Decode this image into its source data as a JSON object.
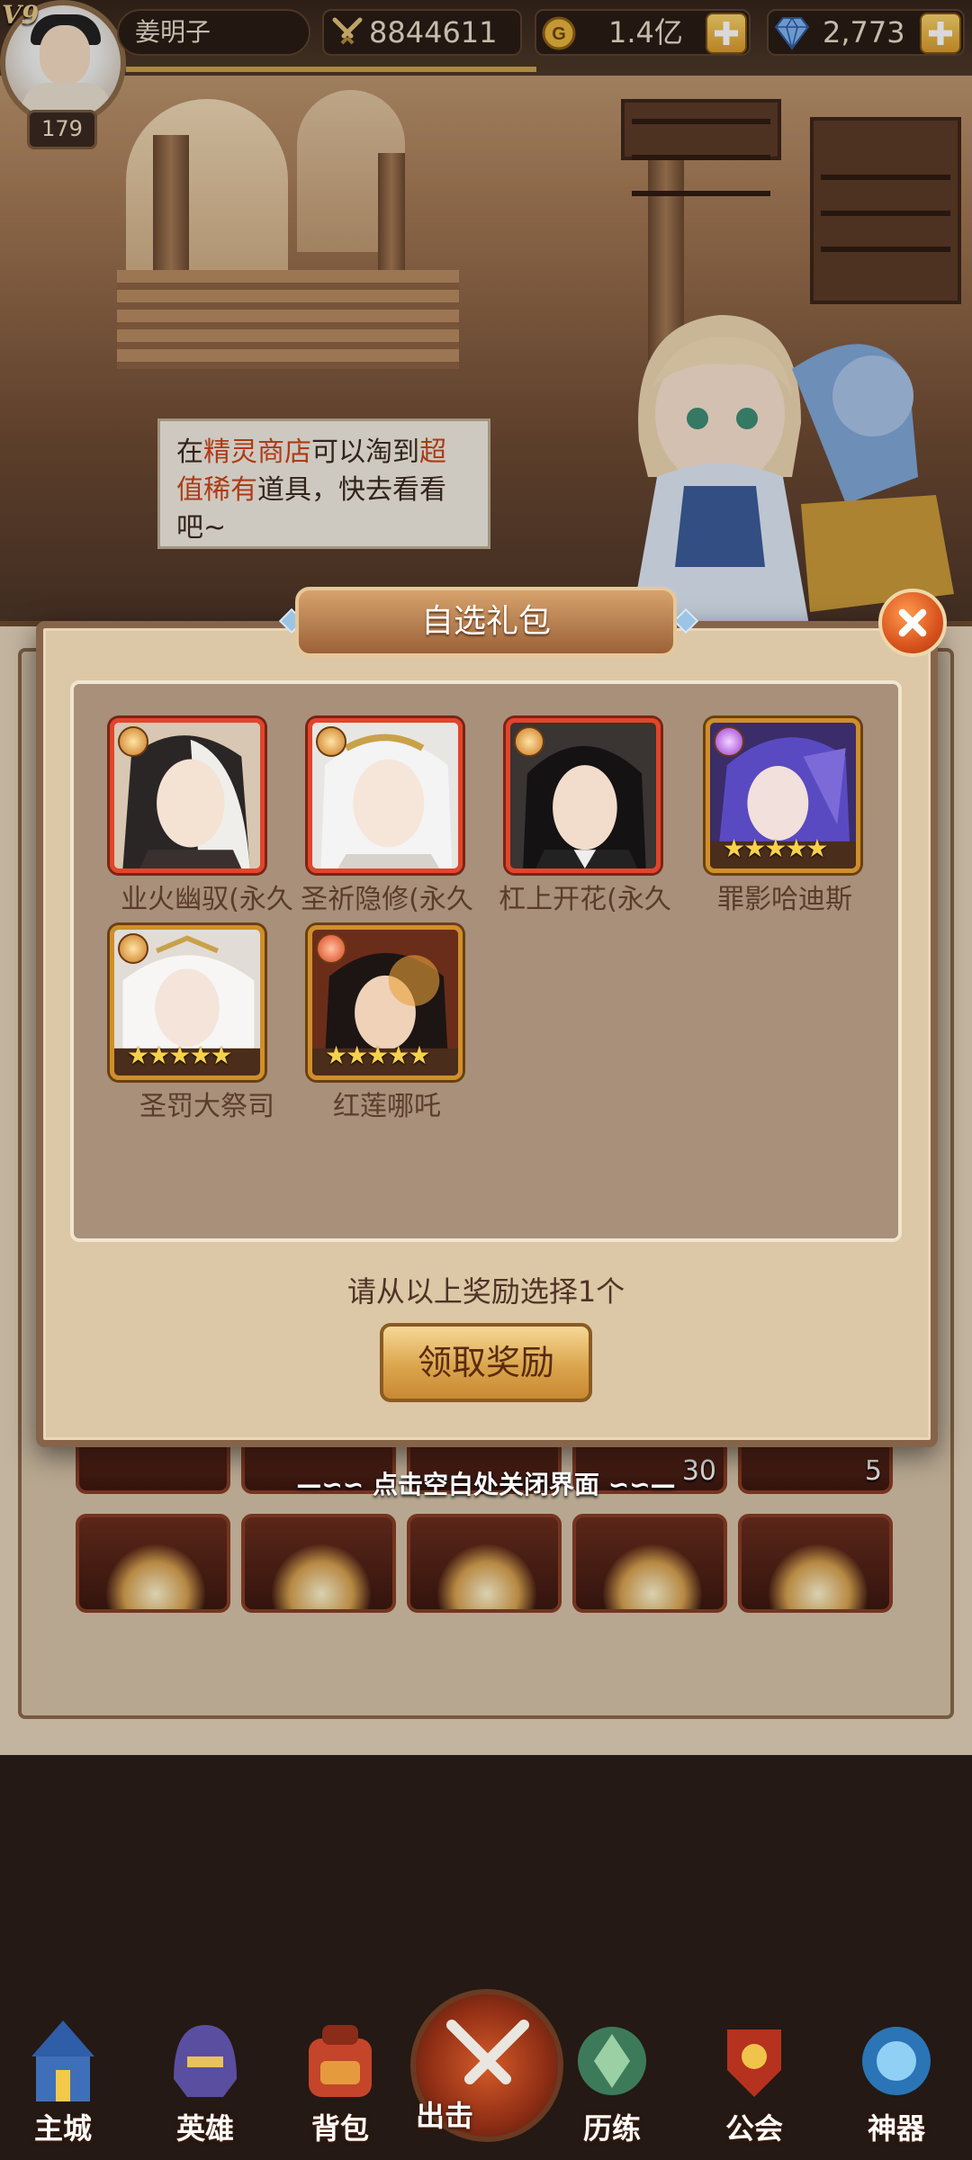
{
  "header": {
    "vip": "V9",
    "level": "179",
    "player_name": "姜明子",
    "power": "8844611",
    "gold": "1.4亿",
    "gems": "2,773"
  },
  "speech_bubble": {
    "part1": "在",
    "highlight1": "精灵商店",
    "part2": "可以淘到",
    "highlight2": "超值稀有",
    "part3": "道具，快去看看吧~"
  },
  "modal": {
    "title": "自选礼包",
    "rewards": [
      {
        "label": "业火幽驭(永久",
        "badge": "clothing-icon"
      },
      {
        "label": "圣祈隐修(永久",
        "badge": "clothing-icon"
      },
      {
        "label": "杠上开花(永久",
        "badge": "clothing-icon"
      },
      {
        "label": "罪影哈迪斯",
        "badge": "violet-element-icon",
        "stars": "★★★★★"
      },
      {
        "label": "圣罚大祭司",
        "badge": "sun-element-icon",
        "stars": "★★★★★"
      },
      {
        "label": "红莲哪吒",
        "badge": "fire-element-icon",
        "stars": "★★★★★"
      }
    ],
    "hint": "请从以上奖励选择1个",
    "claim_button": "领取奖励",
    "close_tip": "—∽∽ 点击空白处关闭界面 ∽∽—"
  },
  "background_slots": {
    "counts": [
      "30",
      "5"
    ]
  },
  "nav": [
    {
      "label": "主城",
      "icon": "castle-icon"
    },
    {
      "label": "英雄",
      "icon": "helmet-icon"
    },
    {
      "label": "背包",
      "icon": "backpack-icon"
    },
    {
      "label": "出击",
      "icon": "crossed-swords-icon"
    },
    {
      "label": "历练",
      "icon": "training-icon"
    },
    {
      "label": "公会",
      "icon": "guild-icon"
    },
    {
      "label": "神器",
      "icon": "artifact-icon"
    }
  ],
  "colors": {
    "accent": "#dba54d",
    "highlight_text": "#c9471a",
    "modal_bg": "#dcc7a6"
  }
}
